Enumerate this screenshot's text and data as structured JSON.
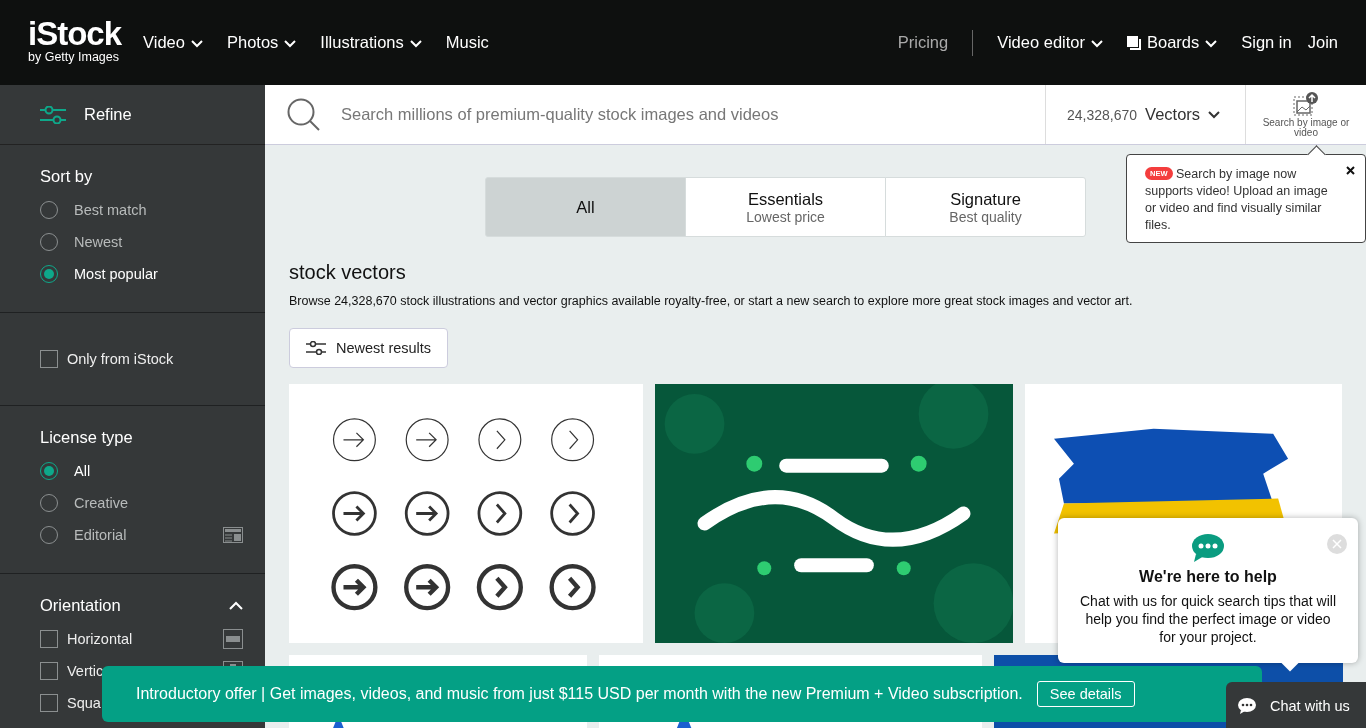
{
  "header": {
    "logo": "iStock",
    "logo_sub": "by Getty Images",
    "nav": [
      {
        "label": "Video",
        "dropdown": true
      },
      {
        "label": "Photos",
        "dropdown": true
      },
      {
        "label": "Illustrations",
        "dropdown": true
      },
      {
        "label": "Music",
        "dropdown": false
      }
    ],
    "pricing": "Pricing",
    "right_nav": [
      {
        "label": "Video editor",
        "kind": "dropdown"
      },
      {
        "label": "Boards",
        "kind": "boards"
      },
      {
        "label": "Sign in",
        "kind": "link"
      },
      {
        "label": "Join",
        "kind": "link"
      }
    ]
  },
  "sidebar": {
    "refine": "Refine",
    "sort": {
      "title": "Sort by",
      "options": [
        {
          "label": "Best match",
          "selected": false
        },
        {
          "label": "Newest",
          "selected": false
        },
        {
          "label": "Most popular",
          "selected": true
        }
      ]
    },
    "only_istock": {
      "label": "Only from iStock",
      "checked": false
    },
    "license": {
      "title": "License type",
      "options": [
        {
          "label": "All",
          "selected": true,
          "info": false
        },
        {
          "label": "Creative",
          "selected": false,
          "info": false
        },
        {
          "label": "Editorial",
          "selected": false,
          "info": true
        }
      ]
    },
    "orientation": {
      "title": "Orientation",
      "expanded": true,
      "options": [
        {
          "label": "Horizontal",
          "checked": false,
          "kind": "horizontal"
        },
        {
          "label": "Vertic",
          "checked": false,
          "kind": "vertical"
        },
        {
          "label": "Squa",
          "checked": false
        }
      ]
    }
  },
  "search": {
    "placeholder": "Search millions of premium-quality stock images and videos",
    "count": "24,328,670",
    "type": "Vectors",
    "image_search": "Search by image or video"
  },
  "tooltip": {
    "badge": "NEW",
    "text": "Search by image now supports video! Upload an image or video and find visually similar files."
  },
  "tabs": [
    {
      "title": "All",
      "selected": true
    },
    {
      "title": "Essentials",
      "subtitle": "Lowest price",
      "selected": false
    },
    {
      "title": "Signature",
      "subtitle": "Best quality",
      "selected": false
    }
  ],
  "heading": "stock vectors",
  "description": "Browse 24,328,670 stock illustrations and vector graphics available royalty-free, or start a new search to explore more great stock images and vector art.",
  "filter_button": "Newest results",
  "images": [
    [
      {
        "kind": "arrows"
      },
      {
        "kind": "shamrock"
      },
      {
        "kind": "flag"
      }
    ],
    [
      {
        "kind": "plain"
      },
      {
        "kind": "plain"
      },
      {
        "kind": "blue"
      }
    ]
  ],
  "banner": {
    "text": "Introductory offer | Get images, videos, and music from just $115 USD per month with the new Premium + Video subscription.",
    "button": "See details"
  },
  "chat": {
    "title": "We're here to help",
    "text": "Chat with us for quick search tips that will help you find the perfect image or video for your project.",
    "button": "Chat with us"
  }
}
